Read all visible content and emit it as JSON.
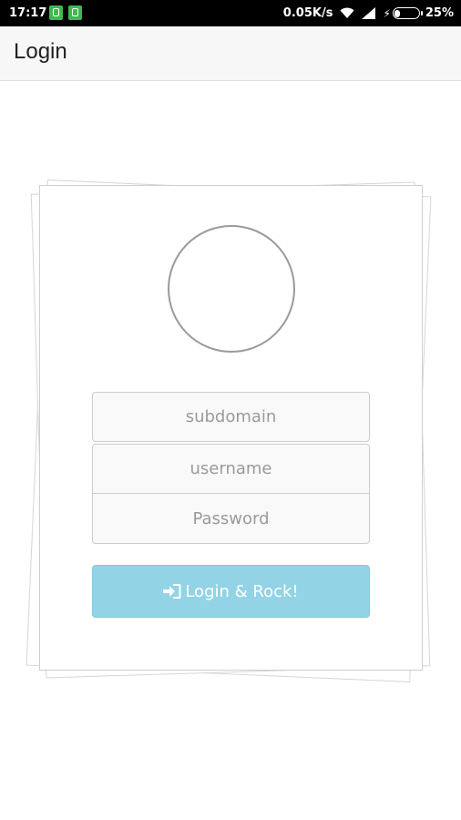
{
  "status_bar": {
    "time": "17:17",
    "network_speed": "0.05K/s",
    "battery_percent": "25%",
    "battery_level": 0.25,
    "notification_icons": [
      "app-notification-icon",
      "alarm-notification-icon"
    ],
    "notification_color": "#3dba4e"
  },
  "app_bar": {
    "title": "Login"
  },
  "form": {
    "subdomain_placeholder": "subdomain",
    "username_placeholder": "username",
    "password_placeholder": "Password",
    "login_label": "Login & Rock!",
    "login_icon": "sign-in-icon",
    "button_color": "#93d3e6"
  }
}
